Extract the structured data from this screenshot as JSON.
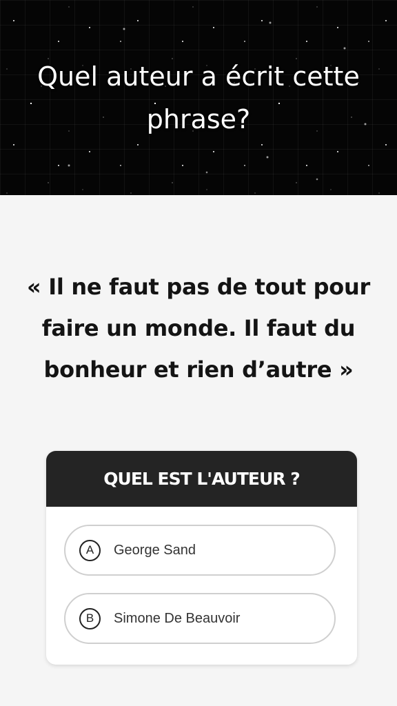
{
  "hero": {
    "title": "Quel auteur a écrit cette phrase?"
  },
  "quote": {
    "text": "« Il ne faut pas de tout pour faire un monde. Il faut du bonheur et rien d’autre »"
  },
  "quiz": {
    "header": "QUEL EST L'AUTEUR ?",
    "options": [
      {
        "letter": "A",
        "label": "George Sand"
      },
      {
        "letter": "B",
        "label": "Simone De Beauvoir"
      }
    ]
  }
}
